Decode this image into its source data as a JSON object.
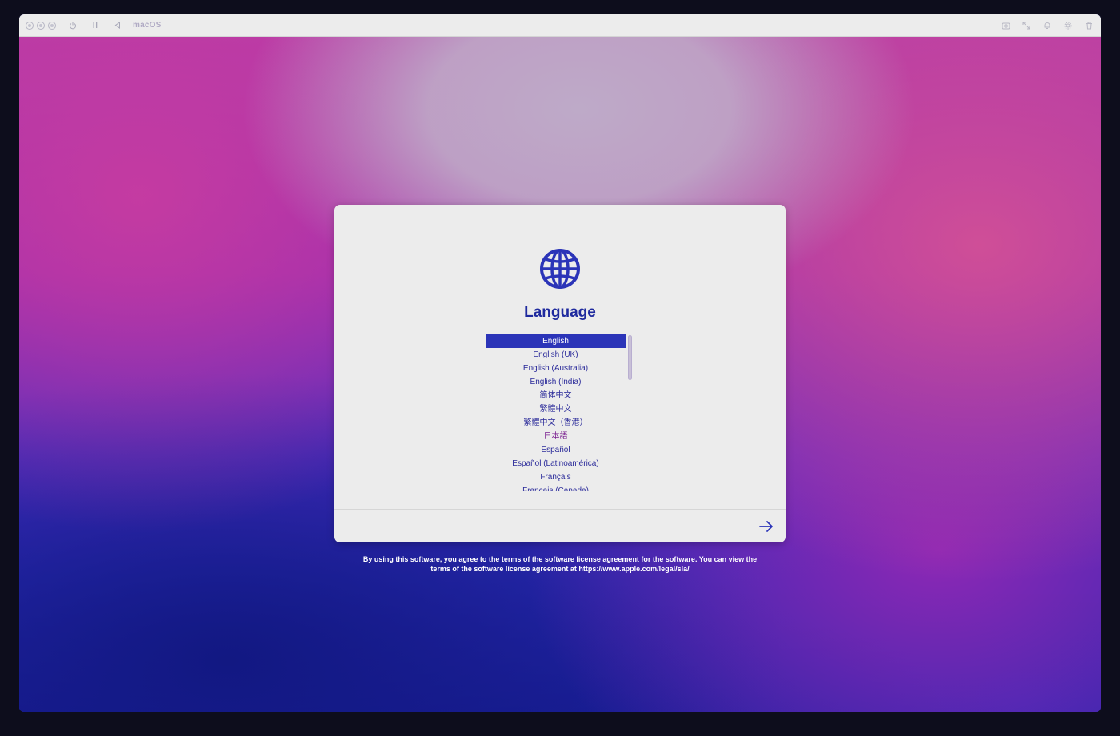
{
  "window": {
    "title": "macOS"
  },
  "setup": {
    "title": "Language",
    "selected_language": "English",
    "languages": [
      "English",
      "English (UK)",
      "English (Australia)",
      "English (India)",
      "简体中文",
      "繁體中文",
      "繁體中文（香港）",
      "日本語",
      "Español",
      "Español (Latinoamérica)",
      "Français",
      "Français (Canada)"
    ]
  },
  "license": {
    "line1": "By using this software, you agree to the terms of the software license agreement for the software. You can view the",
    "line2": "terms of the software license agreement at https://www.apple.com/legal/sla/"
  },
  "icons": {
    "globe": "globe-icon",
    "next": "arrow-right-icon"
  },
  "colors": {
    "accent": "#2b34b8",
    "title": "#1f2a9e",
    "card_bg": "#ececec"
  }
}
